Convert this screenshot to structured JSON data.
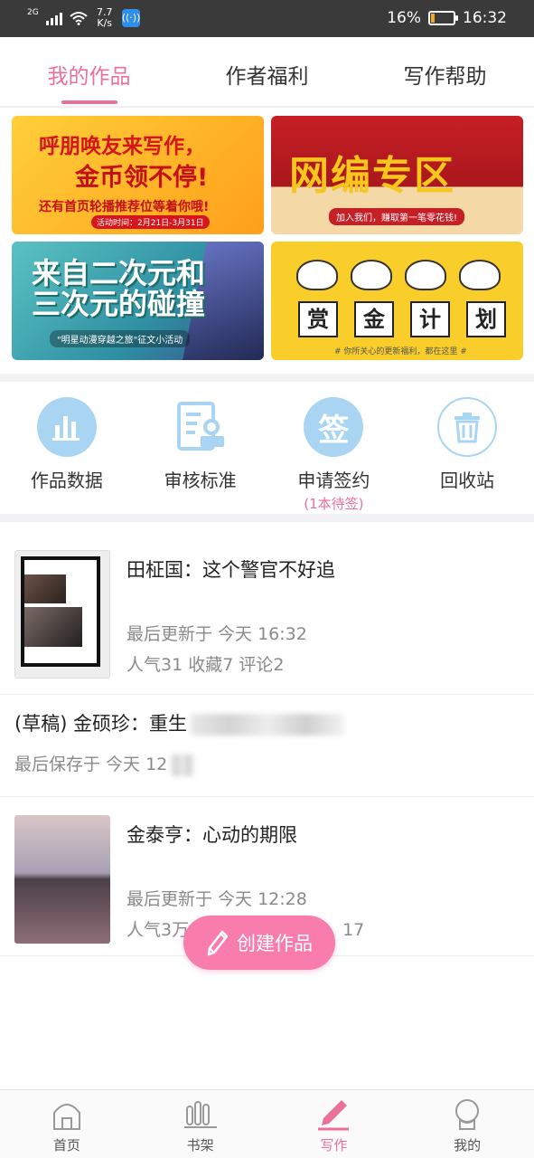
{
  "status_bar": {
    "network": "2G",
    "speed_value": "7.7",
    "speed_unit": "K/s",
    "battery_percent": "16%",
    "time": "16:32",
    "battery_level": 0.16
  },
  "tabs": [
    {
      "label": "我的作品",
      "active": true
    },
    {
      "label": "作者福利",
      "active": false
    },
    {
      "label": "写作帮助",
      "active": false
    }
  ],
  "banners": {
    "b1": {
      "title": "呼朋唤友来写作，",
      "big": "金币领不停!",
      "sub": "还有首页轮播推荐位等着你哦!",
      "date": "活动时间：2月21日-3月31日"
    },
    "b2": {
      "title": "网编专区",
      "sub": "加入我们，赚取第一笔零花钱!"
    },
    "b3": {
      "title": "来自二次元和三次元的碰撞",
      "sub": "\"明星动漫穿越之旅\"征文小活动"
    },
    "b4": {
      "chars": [
        "赏",
        "金",
        "计",
        "划"
      ],
      "sub": "# 你所关心的更新福利，都在这里 #"
    }
  },
  "actions": [
    {
      "label": "作品数据",
      "icon": "bar-chart-icon"
    },
    {
      "label": "审核标准",
      "icon": "review-document-icon"
    },
    {
      "label": "申请签约",
      "icon": "sign-icon",
      "glyph": "签",
      "sub": "(1本待签)"
    },
    {
      "label": "回收站",
      "icon": "trash-icon"
    }
  ],
  "works": [
    {
      "title": "田柾国：这个警官不好追",
      "meta1": "最后更新于 今天 16:32",
      "meta2": "人气31 收藏7 评论2"
    },
    {
      "title_prefix": "(草稿) 金硕珍：重生",
      "meta1": "最后保存于 今天 12"
    },
    {
      "title": "金泰亨：心动的期限",
      "meta1": "最后更新于 今天 12:28",
      "meta2_visible": "人气3万",
      "meta2_tail": "17"
    }
  ],
  "fab": {
    "label": "创建作品"
  },
  "bottom_nav": [
    {
      "label": "首页",
      "icon": "home-icon",
      "active": false
    },
    {
      "label": "书架",
      "icon": "bookshelf-icon",
      "active": false
    },
    {
      "label": "写作",
      "icon": "pen-icon",
      "active": true
    },
    {
      "label": "我的",
      "icon": "profile-icon",
      "active": false
    }
  ],
  "colors": {
    "accent": "#e9709a",
    "icon_blue": "#a9d4f2",
    "fab": "#f97dac"
  }
}
